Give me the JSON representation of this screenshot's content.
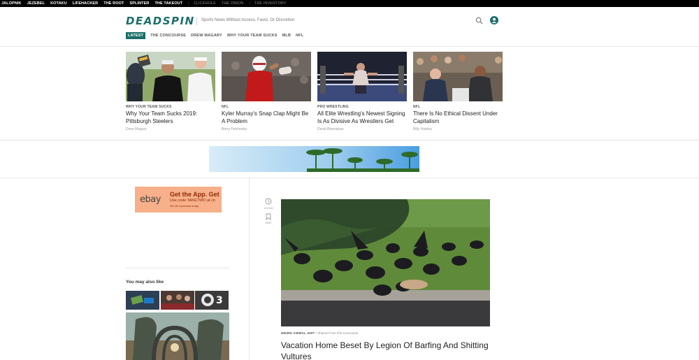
{
  "network_bar": {
    "sites": [
      "JALOPNIK",
      "JEZEBEL",
      "KOTAKU",
      "LIFEHACKER",
      "THE ROOT",
      "SPLINTER",
      "THE TAKEOUT"
    ],
    "dim_sites": [
      "CLICKHOLE",
      "THE ONION",
      "THE INVENTORY"
    ]
  },
  "header": {
    "logo": "DEADSPIN",
    "tagline": "Sports News Without Access, Favor, Or Discretion",
    "nav": [
      "LATEST",
      "THE CONCOURSE",
      "DREW MAGARY",
      "WHY YOUR TEAM SUCKS",
      "MLB",
      "NFL"
    ]
  },
  "featured": [
    {
      "category": "WHY YOUR TEAM SUCKS",
      "title": "Why Your Team Sucks 2019: Pittsburgh Steelers",
      "author": "Drew Magary"
    },
    {
      "category": "NFL",
      "title": "Kyler Murray's Snap Clap Might Be A Problem",
      "author": "Barry Petchesky"
    },
    {
      "category": "PRO WRESTLING",
      "title": "All Elite Wrestling's Newest Signing Is As Divisive As Wrestlers Get",
      "author": "David Bixenspan"
    },
    {
      "category": "NFL",
      "title": "There Is No Ethical Dissent Under Capitalism",
      "author": "Billy Haisley"
    }
  ],
  "sidebar": {
    "ad": {
      "logo": "ebay",
      "headline": "Get the App. Get",
      "code": "Use code TAKETWO at ch",
      "fine": "Min. $5 of purchase in app."
    },
    "you_may_also_like": "You may also like"
  },
  "post": {
    "time": "1:00 AM",
    "save": "SAVE",
    "category": "WEIRD ANIMAL SHIT",
    "shared_from": "Shared From The Concourse",
    "title": "Vacation Home Beset By Legion Of Barfing And Shitting Vultures"
  },
  "colors": {
    "brand": "#1b6e6a",
    "ad_bg": "#f8b08a"
  }
}
